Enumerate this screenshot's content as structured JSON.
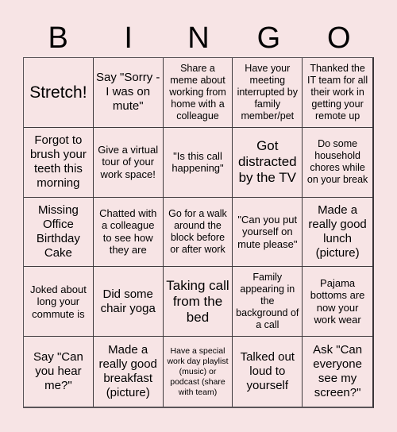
{
  "header": {
    "letters": [
      "B",
      "I",
      "N",
      "G",
      "O"
    ]
  },
  "cells": [
    "Stretch!",
    "Say \"Sorry - I was on mute\"",
    "Share a meme about working from home with a colleague",
    "Have your meeting interrupted by family member/pet",
    "Thanked the IT team for all their work in getting your remote up",
    "Forgot to brush your teeth this morning",
    "Give a virtual tour of your work space!",
    "\"Is this call happening\"",
    "Got distracted by the TV",
    "Do some household chores while on your break",
    "Missing Office Birthday Cake",
    "Chatted with a colleague to see how they are",
    "Go for a walk around the block before or after work",
    "\"Can you put yourself on mute please\"",
    "Made a really good lunch (picture)",
    "Joked about long your commute is",
    "Did some chair yoga",
    "Taking call from the bed",
    "Family appearing in the background of a call",
    "Pajama bottoms are now your work wear",
    "Say \"Can you hear me?\"",
    "Made a really good breakfast (picture)",
    "Have a special work day playlist (music) or podcast (share with team)",
    "Talked out loud to yourself",
    "Ask \"Can everyone see my screen?\""
  ],
  "colors": {
    "background": "#f7e4e5",
    "grid_line": "#3f3a3d",
    "text": "#000000"
  }
}
